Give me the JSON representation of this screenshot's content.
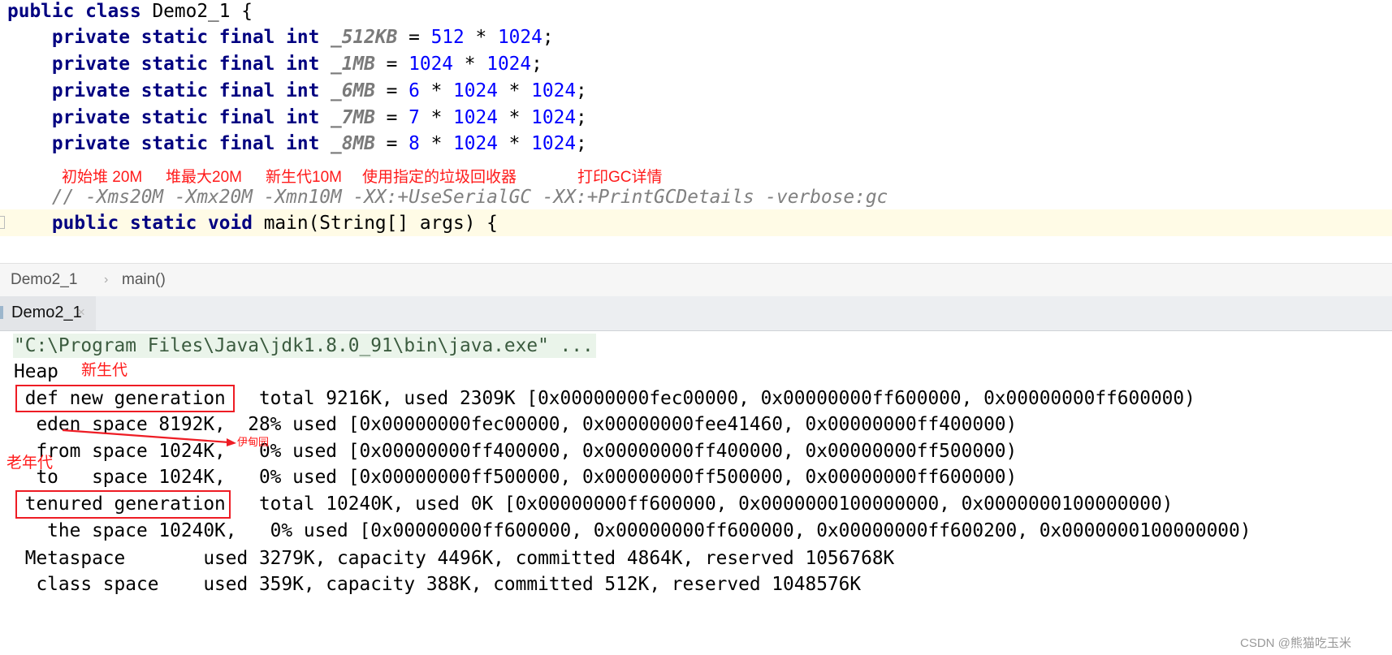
{
  "editor": {
    "code_lines": [
      [
        {
          "t": "kw",
          "v": "public class "
        },
        {
          "t": "plain",
          "v": "Demo2_1 {"
        }
      ],
      [
        {
          "t": "kw",
          "v": "    private static final int "
        },
        {
          "t": "const",
          "v": "_512KB"
        },
        {
          "t": "plain",
          "v": " = "
        },
        {
          "t": "num",
          "v": "512"
        },
        {
          "t": "plain",
          "v": " * "
        },
        {
          "t": "num",
          "v": "1024"
        },
        {
          "t": "plain",
          "v": ";"
        }
      ],
      [
        {
          "t": "kw",
          "v": "    private static final int "
        },
        {
          "t": "const",
          "v": "_1MB"
        },
        {
          "t": "plain",
          "v": " = "
        },
        {
          "t": "num",
          "v": "1024"
        },
        {
          "t": "plain",
          "v": " * "
        },
        {
          "t": "num",
          "v": "1024"
        },
        {
          "t": "plain",
          "v": ";"
        }
      ],
      [
        {
          "t": "kw",
          "v": "    private static final int "
        },
        {
          "t": "const",
          "v": "_6MB"
        },
        {
          "t": "plain",
          "v": " = "
        },
        {
          "t": "num",
          "v": "6"
        },
        {
          "t": "plain",
          "v": " * "
        },
        {
          "t": "num",
          "v": "1024"
        },
        {
          "t": "plain",
          "v": " * "
        },
        {
          "t": "num",
          "v": "1024"
        },
        {
          "t": "plain",
          "v": ";"
        }
      ],
      [
        {
          "t": "kw",
          "v": "    private static final int "
        },
        {
          "t": "const",
          "v": "_7MB"
        },
        {
          "t": "plain",
          "v": " = "
        },
        {
          "t": "num",
          "v": "7"
        },
        {
          "t": "plain",
          "v": " * "
        },
        {
          "t": "num",
          "v": "1024"
        },
        {
          "t": "plain",
          "v": " * "
        },
        {
          "t": "num",
          "v": "1024"
        },
        {
          "t": "plain",
          "v": ";"
        }
      ],
      [
        {
          "t": "kw",
          "v": "    private static final int "
        },
        {
          "t": "const",
          "v": "_8MB"
        },
        {
          "t": "plain",
          "v": " = "
        },
        {
          "t": "num",
          "v": "8"
        },
        {
          "t": "plain",
          "v": " * "
        },
        {
          "t": "num",
          "v": "1024"
        },
        {
          "t": "plain",
          "v": " * "
        },
        {
          "t": "num",
          "v": "1024"
        },
        {
          "t": "plain",
          "v": ";"
        }
      ]
    ],
    "comment_line": [
      {
        "t": "cmt",
        "v": "    // -Xms20M -Xmx20M -Xmn10M -XX:+UseSerialGC -XX:+PrintGCDetails -verbose:gc"
      }
    ],
    "main_line": [
      {
        "t": "kw",
        "v": "    public static void "
      },
      {
        "t": "plain",
        "v": "main(String[] args) {"
      }
    ],
    "annotations": [
      "初始堆 20M",
      "堆最大20M",
      "新生代10M",
      "使用指定的垃圾回收器",
      "打印GC详情"
    ]
  },
  "breadcrumb": {
    "items": [
      "Demo2_1",
      "main()"
    ],
    "separator": "›"
  },
  "run_panel": {
    "tab_label": "Demo2_1",
    "tab_close": "×",
    "console_lines": [
      "\"C:\\Program Files\\Java\\jdk1.8.0_91\\bin\\java.exe\" ...",
      "Heap",
      " def new generation   total 9216K, used 2309K [0x00000000fec00000, 0x00000000ff600000, 0x00000000ff600000)",
      "  eden space 8192K,  28% used [0x00000000fec00000, 0x00000000fee41460, 0x00000000ff400000)",
      "  from space 1024K,   0% used [0x00000000ff400000, 0x00000000ff400000, 0x00000000ff500000)",
      "  to   space 1024K,   0% used [0x00000000ff500000, 0x00000000ff500000, 0x00000000ff600000)",
      " tenured generation   total 10240K, used 0K [0x00000000ff600000, 0x0000000100000000, 0x0000000100000000)",
      "   the space 10240K,   0% used [0x00000000ff600000, 0x00000000ff600000, 0x00000000ff600200, 0x0000000100000000)",
      " Metaspace       used 3279K, capacity 4496K, committed 4864K, reserved 1056768K",
      "  class space    used 359K, capacity 388K, committed 512K, reserved 1048576K"
    ],
    "annotations": {
      "young_gen": "新生代",
      "old_gen": "老年代",
      "eden": "伊甸园"
    }
  },
  "watermark": "CSDN @熊猫吃玉米",
  "colors": {
    "annotation": "#ee1c24",
    "keyword": "#000080",
    "number": "#0000ff"
  }
}
